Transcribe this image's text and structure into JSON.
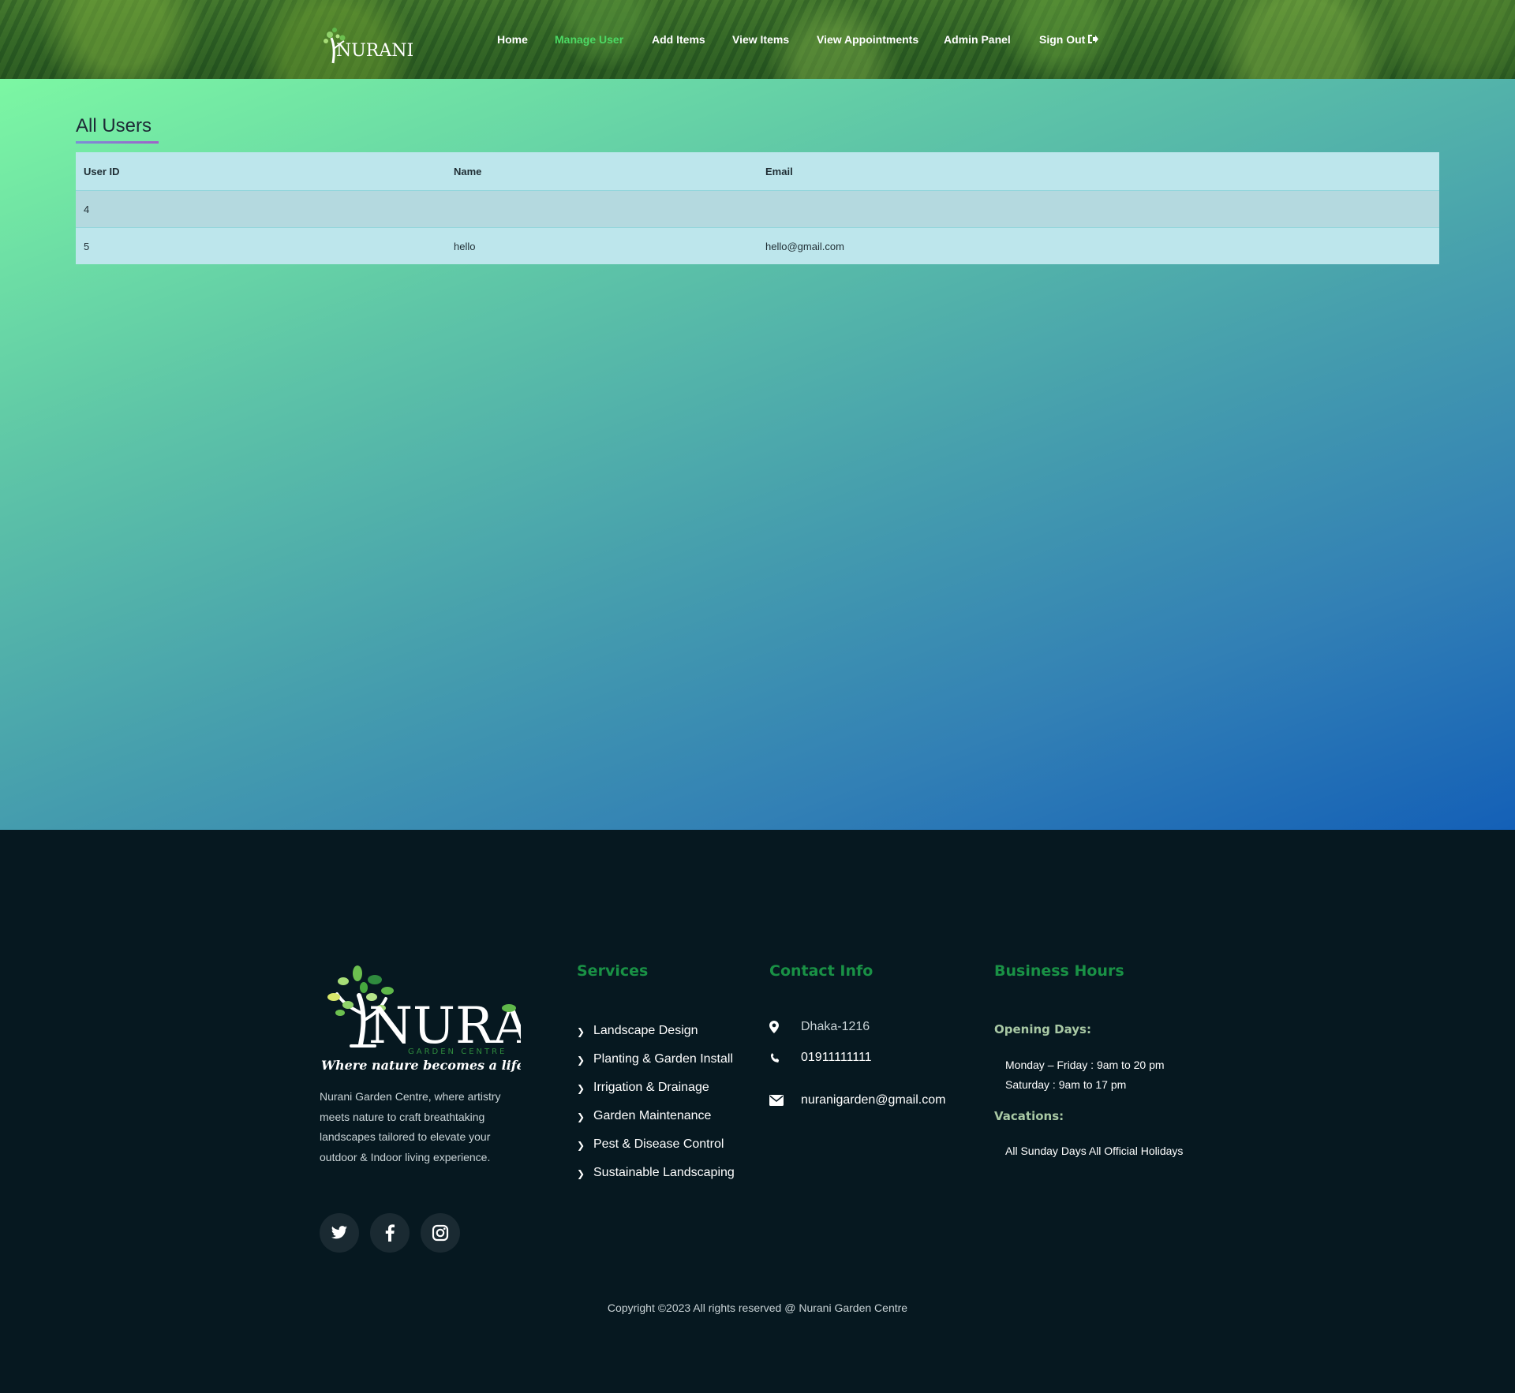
{
  "brand": {
    "logo_text": "NURANI",
    "tagline": "Where nature becomes a lifestyle",
    "subtitle": "GARDEN CENTRE"
  },
  "nav": {
    "items": [
      {
        "label": "Home"
      },
      {
        "label": "Manage User",
        "active": true
      },
      {
        "label": "Add Items"
      },
      {
        "label": "View Items"
      },
      {
        "label": "View Appointments"
      },
      {
        "label": "Admin Panel"
      },
      {
        "label": "Sign Out",
        "icon": "sign-out-icon"
      }
    ],
    "active_color": "#4cd964"
  },
  "main": {
    "title": "All Users",
    "table": {
      "headers": [
        "User ID",
        "Name",
        "Email"
      ],
      "rows": [
        {
          "id": "4",
          "name": "",
          "email": ""
        },
        {
          "id": "5",
          "name": "hello",
          "email": "hello@gmail.com"
        }
      ]
    }
  },
  "footer": {
    "about": "Nurani Garden Centre, where artistry meets nature to craft breathtaking landscapes tailored to elevate your outdoor & Indoor living experience.",
    "socials": [
      "twitter-icon",
      "facebook-icon",
      "instagram-icon"
    ],
    "services": {
      "heading": "Services",
      "items": [
        "Landscape Design",
        "Planting & Garden Install",
        "Irrigation & Drainage",
        "Garden Maintenance",
        "Pest & Disease Control",
        "Sustainable Landscaping"
      ]
    },
    "contact": {
      "heading": "Contact Info",
      "address": "Dhaka-1216",
      "phone": "01911111111",
      "email": "nuranigarden@gmail.com"
    },
    "hours": {
      "heading": "Business Hours",
      "opening_label": "Opening Days:",
      "weekdays": "Monday – Friday : 9am to 20 pm",
      "saturday": "Saturday : 9am to 17 pm",
      "vacations_label": "Vacations:",
      "vacations": "All Sunday Days All Official Holidays"
    },
    "copyright": "Copyright ©2023 All rights reserved @ Nurani Garden Centre",
    "heading_color": "#199145"
  }
}
